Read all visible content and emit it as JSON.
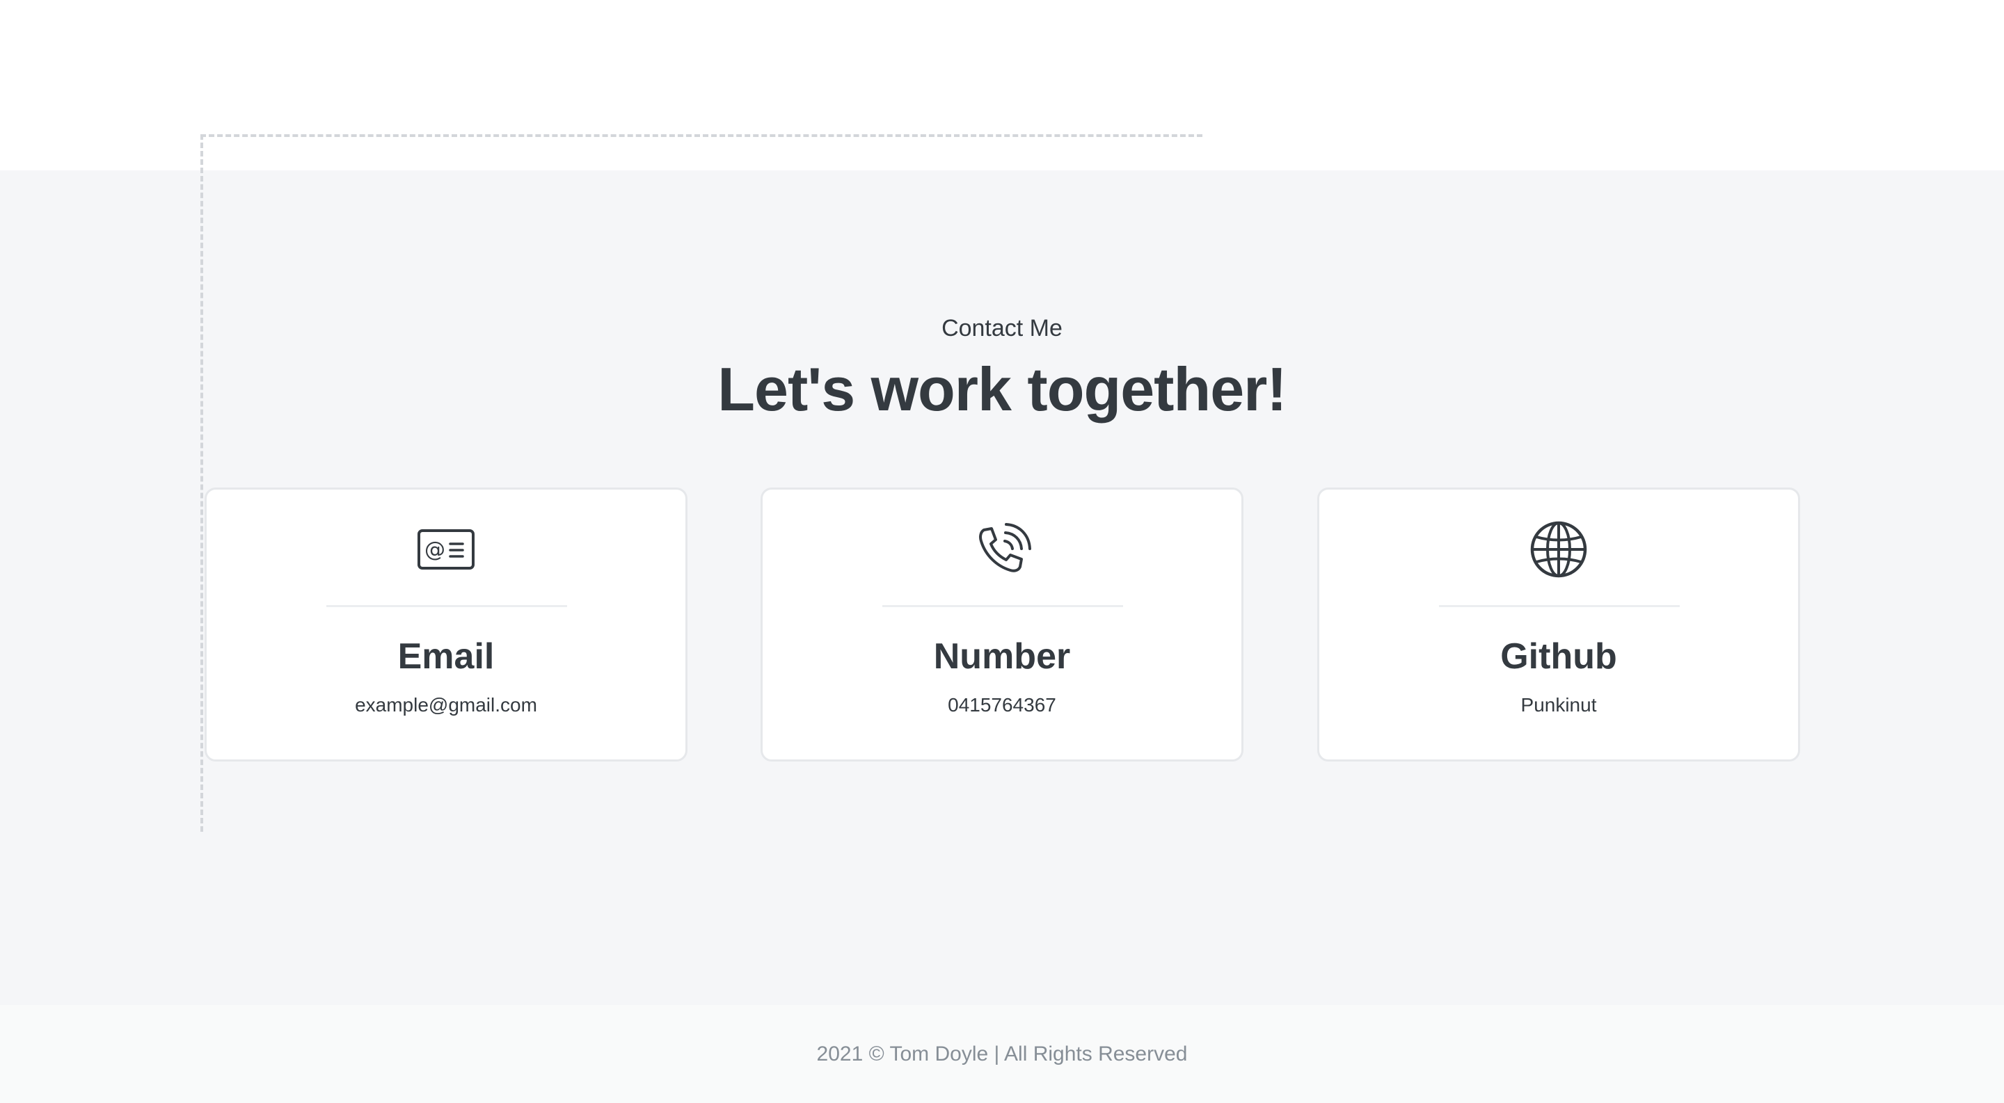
{
  "contact": {
    "eyebrow": "Contact Me",
    "headline": "Let's work together!",
    "cards": [
      {
        "icon": "email-contact-card-icon",
        "title": "Email",
        "value": "example@gmail.com"
      },
      {
        "icon": "phone-ringing-icon",
        "title": "Number",
        "value": "0415764367"
      },
      {
        "icon": "globe-icon",
        "title": "Github",
        "value": "Punkinut"
      }
    ]
  },
  "footer": {
    "copyright": "2021 © Tom Doyle | All Rights Reserved"
  },
  "colors": {
    "text": "#343a40",
    "section_background": "#f5f6f8",
    "card_border": "#e6e8eb",
    "muted_text": "#868e96"
  }
}
